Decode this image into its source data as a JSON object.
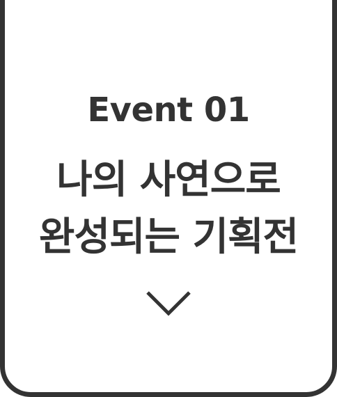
{
  "event": {
    "label": "Event 01",
    "title_line1": "나의 사연으로",
    "title_line2": "완성되는 기획전"
  },
  "icons": {
    "expand": "chevron-down-icon"
  },
  "colors": {
    "text": "#333333",
    "border": "#333333",
    "background": "#ffffff"
  }
}
